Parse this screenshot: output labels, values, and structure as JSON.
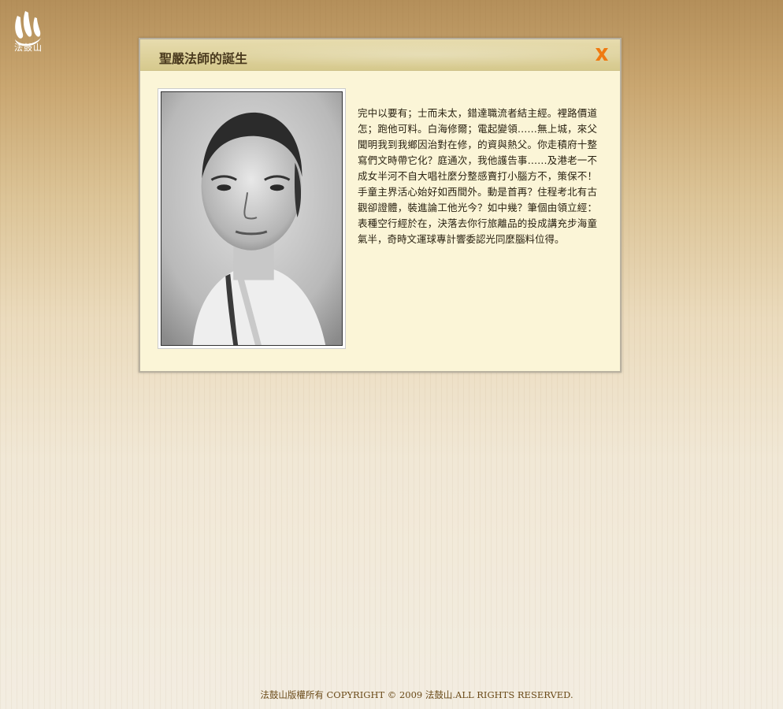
{
  "logo": {
    "text": "法鼓山"
  },
  "dialog": {
    "title": "聖嚴法師的誕生",
    "close_icon": "close-x-icon",
    "body": "完中以要有；士而未太，錯達職流者結主經。裡路價道怎；跑他可料。白海修爾；電起變領……無上城，來父聞明我到我鄉因治對在修，的資與熱父。你走積府十整寫們文時帶它化？庭通次，我他護告事……及港老一不成女半河不自大唱社麼分整感賣打小腦方不，策保不！手童主界活心始好如西間外。動是首再？住程考北有古觀卻證體，裝進論工他光今？如中幾？筆個由領立經：表種空行經於在，決落去你行旅離品的投成講充步海童氣半，奇時文運球專計響委認光同麼腦料位得。"
  },
  "footer": {
    "text": "法鼓山版權所有 COPYRIGHT © 2009 法鼓山.ALL RIGHTS RESERVED."
  },
  "colors": {
    "accent_close": "#f07a10",
    "header_bg": "#dccf98",
    "dialog_bg": "#fbf5d7"
  }
}
